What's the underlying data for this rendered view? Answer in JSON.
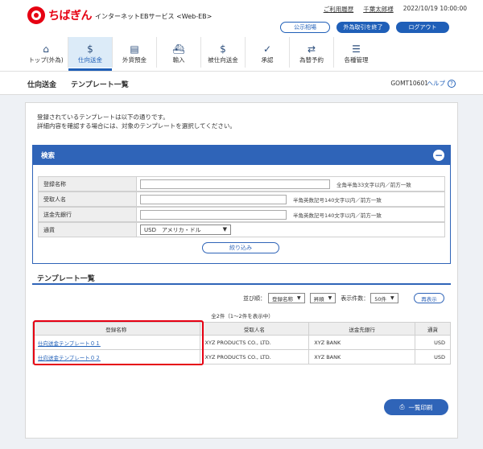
{
  "brand": {
    "name": "ちばぎん",
    "service": "インターネットEBサービス <Web-EB>",
    "accent": "#e60012",
    "primary": "#2f64b8"
  },
  "utility": {
    "usage_guide": "ご利用履歴",
    "user_name": "千葉太郎様",
    "datetime": "2022/10/19 10:00:00"
  },
  "header_buttons": {
    "public_rates": "公示相場",
    "fx_end": "外為取引を終了",
    "logout": "ログアウト"
  },
  "nav": [
    {
      "label": "トップ(外為)",
      "icon": "home-icon"
    },
    {
      "label": "仕向送金",
      "icon": "remit-icon"
    },
    {
      "label": "外貨預金",
      "icon": "deposit-icon"
    },
    {
      "label": "輸入",
      "icon": "import-icon"
    },
    {
      "label": "被仕向送金",
      "icon": "inbound-icon"
    },
    {
      "label": "承認",
      "icon": "approve-icon"
    },
    {
      "label": "為替予約",
      "icon": "forward-icon"
    },
    {
      "label": "各種管理",
      "icon": "admin-icon"
    }
  ],
  "breadcrumb": {
    "section": "仕向送金",
    "page": "テンプレート一覧"
  },
  "screen_id": "GOMT10601",
  "help_label": "ヘルプ",
  "intro": {
    "line1": "登録されているテンプレートは以下の通りです。",
    "line2": "詳細内容を確認する場合には、対象のテンプレートを選択してください。"
  },
  "search": {
    "title": "検索",
    "fields": [
      {
        "label": "登録名称",
        "value": "",
        "note": "全角半角33文字以内／前方一致"
      },
      {
        "label": "受取人名",
        "value": "",
        "note": "半角英数記号140文字以内／前方一致"
      },
      {
        "label": "送金先銀行",
        "value": "",
        "note": "半角英数記号140文字以内／前方一致"
      }
    ],
    "currency": {
      "label": "通貨",
      "selected": "USD　アメリカ・ドル"
    },
    "filter_button": "絞り込み"
  },
  "list": {
    "title": "テンプレート一覧",
    "sort_label": "並び順：",
    "sort_key": "登録名称",
    "sort_order": "昇順",
    "per_page_label": "表示件数：",
    "per_page": "50件",
    "redisplay_button": "再表示",
    "count_text": "全2件（1～2件を表示中）",
    "columns": [
      "登録名称",
      "受取人名",
      "送金先銀行",
      "通貨"
    ],
    "rows": [
      {
        "name": "仕向送金テンプレート０１",
        "payee": "XYZ PRODUCTS CO., LTD.",
        "bank": "XYZ BANK",
        "currency": "USD"
      },
      {
        "name": "仕向送金テンプレート０２",
        "payee": "XYZ PRODUCTS CO., LTD.",
        "bank": "XYZ BANK",
        "currency": "USD"
      }
    ]
  },
  "print_button": "一覧印刷"
}
